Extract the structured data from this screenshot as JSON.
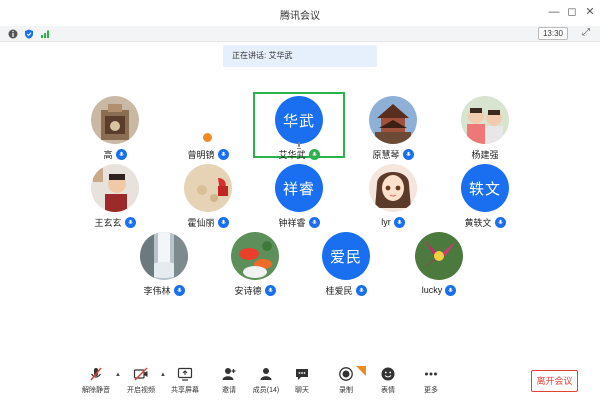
{
  "window": {
    "title": "腾讯会议",
    "clock": "13:30"
  },
  "speaking": {
    "text": "正在讲话: 艾华武"
  },
  "participants": [
    {
      "name": "高",
      "avatar_type": "photo-shrine",
      "mic": "blue"
    },
    {
      "name": "曾明镜",
      "avatar_type": "none",
      "mic": "blue",
      "host": true
    },
    {
      "name": "艾华武",
      "avatar_text": "华武",
      "mic": "green",
      "speaking": true
    },
    {
      "name": "原慧琴",
      "avatar_type": "photo-pagoda",
      "mic": "blue"
    },
    {
      "name": "杨建强",
      "avatar_type": "photo-kids",
      "mic": "none"
    },
    {
      "name": "王玄玄",
      "avatar_type": "photo-child",
      "mic": "blue"
    },
    {
      "name": "霍仙丽",
      "avatar_type": "photo-sand",
      "mic": "blue"
    },
    {
      "name": "钟祥睿",
      "avatar_text": "祥睿",
      "mic": "blue"
    },
    {
      "name": "lyr",
      "avatar_type": "photo-cartoon-girl",
      "mic": "blue"
    },
    {
      "name": "黄轶文",
      "avatar_text": "轶文",
      "mic": "blue"
    },
    {
      "name": "李伟林",
      "avatar_type": "photo-waterfall",
      "mic": "blue"
    },
    {
      "name": "安诗德",
      "avatar_type": "photo-goldfish",
      "mic": "blue"
    },
    {
      "name": "桂爱民",
      "avatar_text": "爱民",
      "mic": "blue"
    },
    {
      "name": "lucky",
      "avatar_type": "photo-flower",
      "mic": "blue"
    }
  ],
  "toolbar": {
    "unmute": "解除静音",
    "video": "开启视频",
    "share": "共享屏幕",
    "invite": "邀请",
    "members": "成员(14)",
    "chat": "聊天",
    "record": "录制",
    "reactions": "表情",
    "more": "更多",
    "leave": "离开会议"
  },
  "colors": {
    "accent": "#1a6ff0",
    "speaking": "#2bb24c",
    "leave": "#e0433a",
    "banner": "#e6effc"
  }
}
